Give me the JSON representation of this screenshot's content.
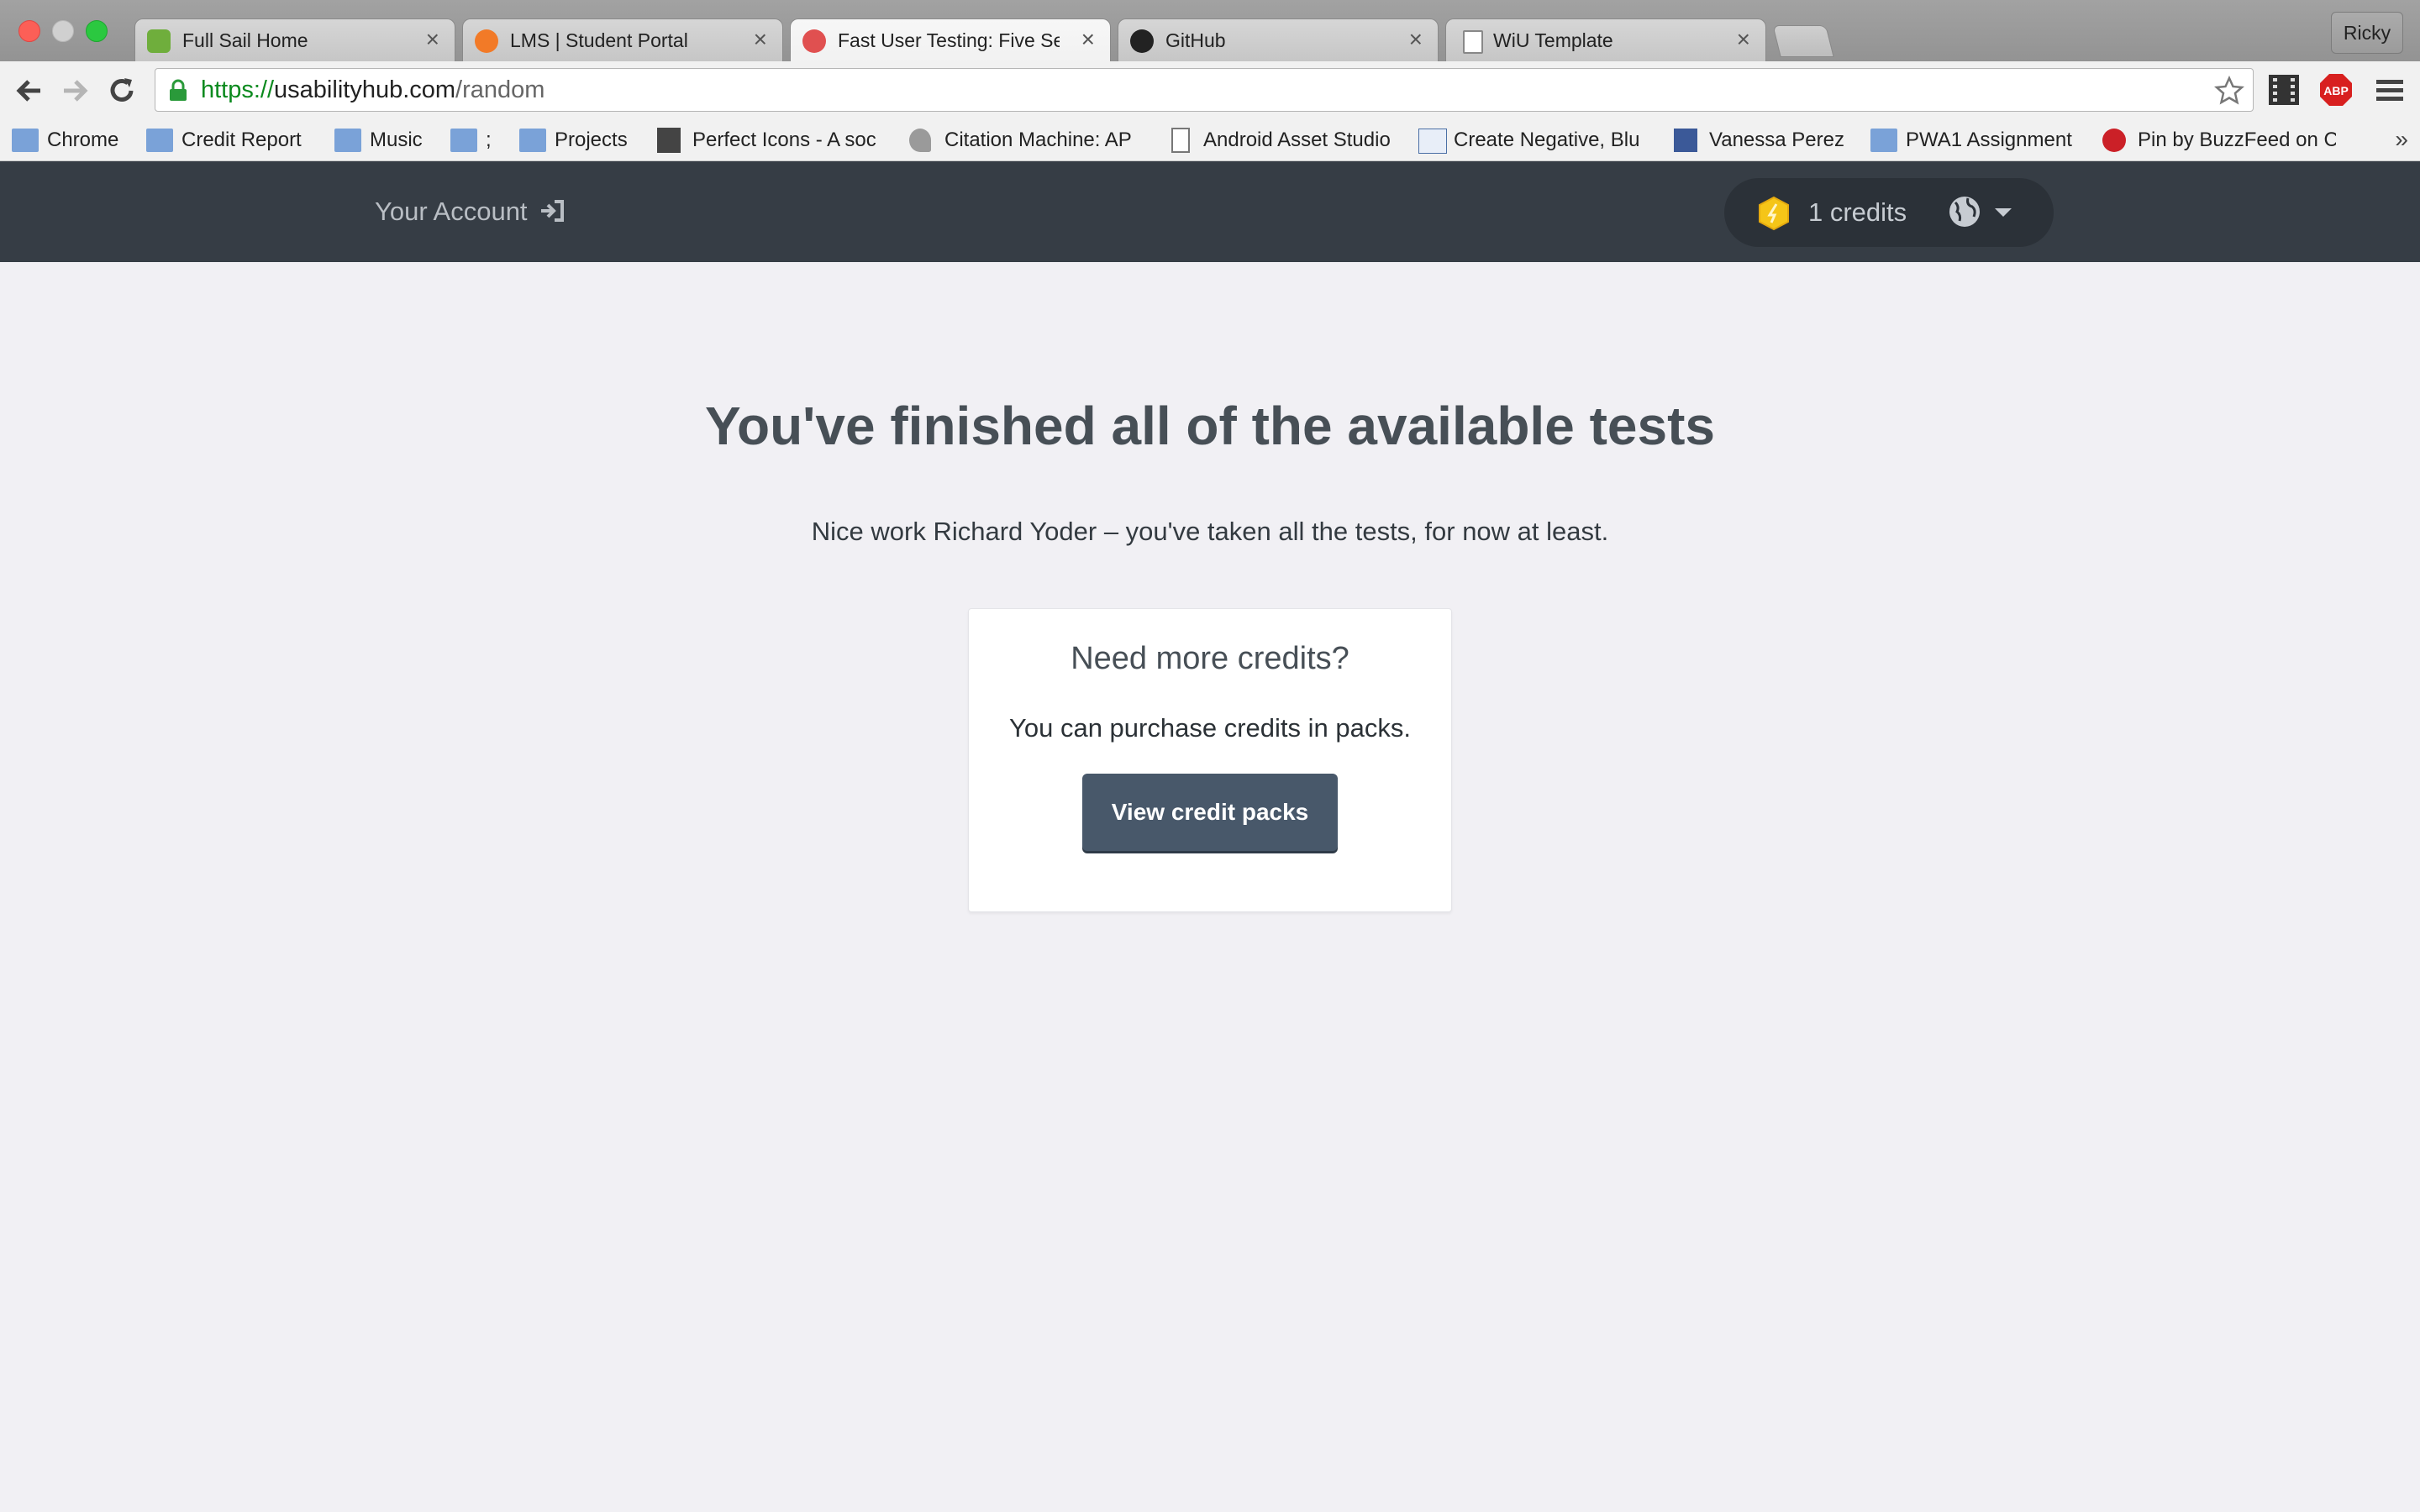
{
  "browser": {
    "tabs": [
      {
        "title": "Full Sail Home",
        "favicon": "fullsail-favicon",
        "color": "#6fae3c"
      },
      {
        "title": "LMS | Student Portal",
        "favicon": "lms-favicon",
        "color": "#f27a27"
      },
      {
        "title": "Fast User Testing: Five Sec",
        "favicon": "usabilityhub-favicon",
        "color": "#e05050"
      },
      {
        "title": "GitHub",
        "favicon": "github-favicon",
        "color": "#222222"
      },
      {
        "title": "WiU Template",
        "favicon": "document-favicon",
        "color": "#888888"
      }
    ],
    "active_tab_index": 2,
    "profile": "Ricky",
    "url": {
      "scheme": "https://",
      "host": "usabilityhub.com",
      "path": "/random"
    },
    "bookmarks": [
      {
        "label": "Chrome",
        "icon": "folder-icon"
      },
      {
        "label": "Credit Report",
        "icon": "folder-icon"
      },
      {
        "label": "Music",
        "icon": "folder-icon"
      },
      {
        "label": ";",
        "icon": "folder-icon"
      },
      {
        "label": "Projects",
        "icon": "folder-icon"
      },
      {
        "label": "Perfect Icons - A soc",
        "icon": "pi-icon"
      },
      {
        "label": "Citation Machine: AP",
        "icon": "squirrel-icon"
      },
      {
        "label": "Android Asset Studio",
        "icon": "page-icon"
      },
      {
        "label": "Create Negative, Blu",
        "icon": "hg-icon"
      },
      {
        "label": "Vanessa Perez",
        "icon": "facebook-icon"
      },
      {
        "label": "PWA1 Assignment",
        "icon": "folder-icon"
      },
      {
        "label": "Pin by BuzzFeed on C",
        "icon": "pinterest-icon"
      }
    ],
    "bookmarks_overflow": "»",
    "extension_label": "ABP"
  },
  "site": {
    "account_link": "Your Account",
    "credits": "1 credits",
    "accent_color": "#f5c518"
  },
  "main": {
    "heading": "You've finished all of the available tests",
    "subtext": "Nice work Richard Yoder – you've taken all the tests, for now at least.",
    "card": {
      "title": "Need more credits?",
      "text": "You can purchase credits in packs.",
      "button_label": "View credit packs"
    }
  }
}
